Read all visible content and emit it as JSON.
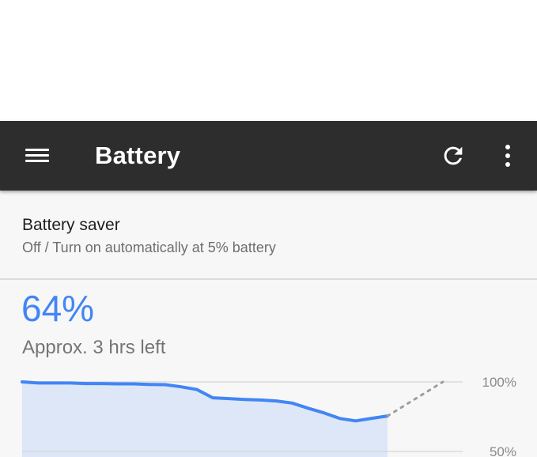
{
  "toolbar": {
    "title": "Battery",
    "menu_icon": "menu-icon",
    "refresh_icon": "refresh-icon",
    "overflow_icon": "more-vert-icon"
  },
  "battery_saver": {
    "title": "Battery saver",
    "summary": "Off / Turn on automatically at 5% battery"
  },
  "battery": {
    "percent_text": "64%",
    "time_left": "Approx. 3 hrs left"
  },
  "colors": {
    "accent": "#4285f4",
    "toolbar_bg": "#2d2d2d",
    "content_bg": "#f7f7f7"
  },
  "chart_data": {
    "type": "area",
    "ylim": [
      50,
      100
    ],
    "y_ticks": [
      "100%",
      "50%"
    ],
    "grid": true,
    "series": [
      {
        "values": [
          100,
          99.2,
          99.2,
          99.2,
          98.8,
          98.8,
          98.6,
          98.6,
          98.2,
          98.0,
          96.5,
          94.5,
          88.6,
          88.0,
          87.4,
          87.0,
          86.3,
          84.8,
          81.1,
          77.7,
          73.7,
          72.0,
          73.8,
          75.5
        ]
      }
    ],
    "projection": {
      "from": 75.5,
      "to": 100
    }
  }
}
